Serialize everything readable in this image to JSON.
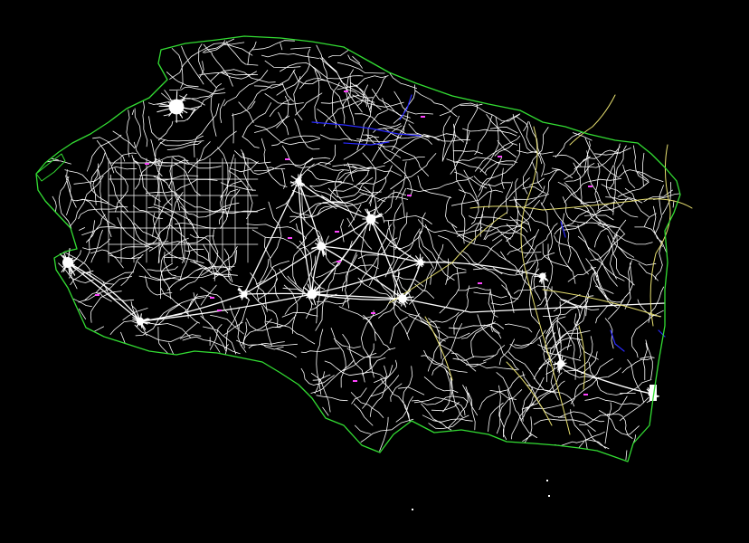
{
  "view": {
    "background": "#000000"
  },
  "layers": {
    "coastline": {
      "color": "#33dd33"
    },
    "roads": {
      "color": "#ffffff"
    },
    "main_roads": {
      "color": "#e8e070"
    },
    "rivers": {
      "color": "#2a2aff"
    },
    "markers": {
      "color": "#ff44ff"
    }
  }
}
